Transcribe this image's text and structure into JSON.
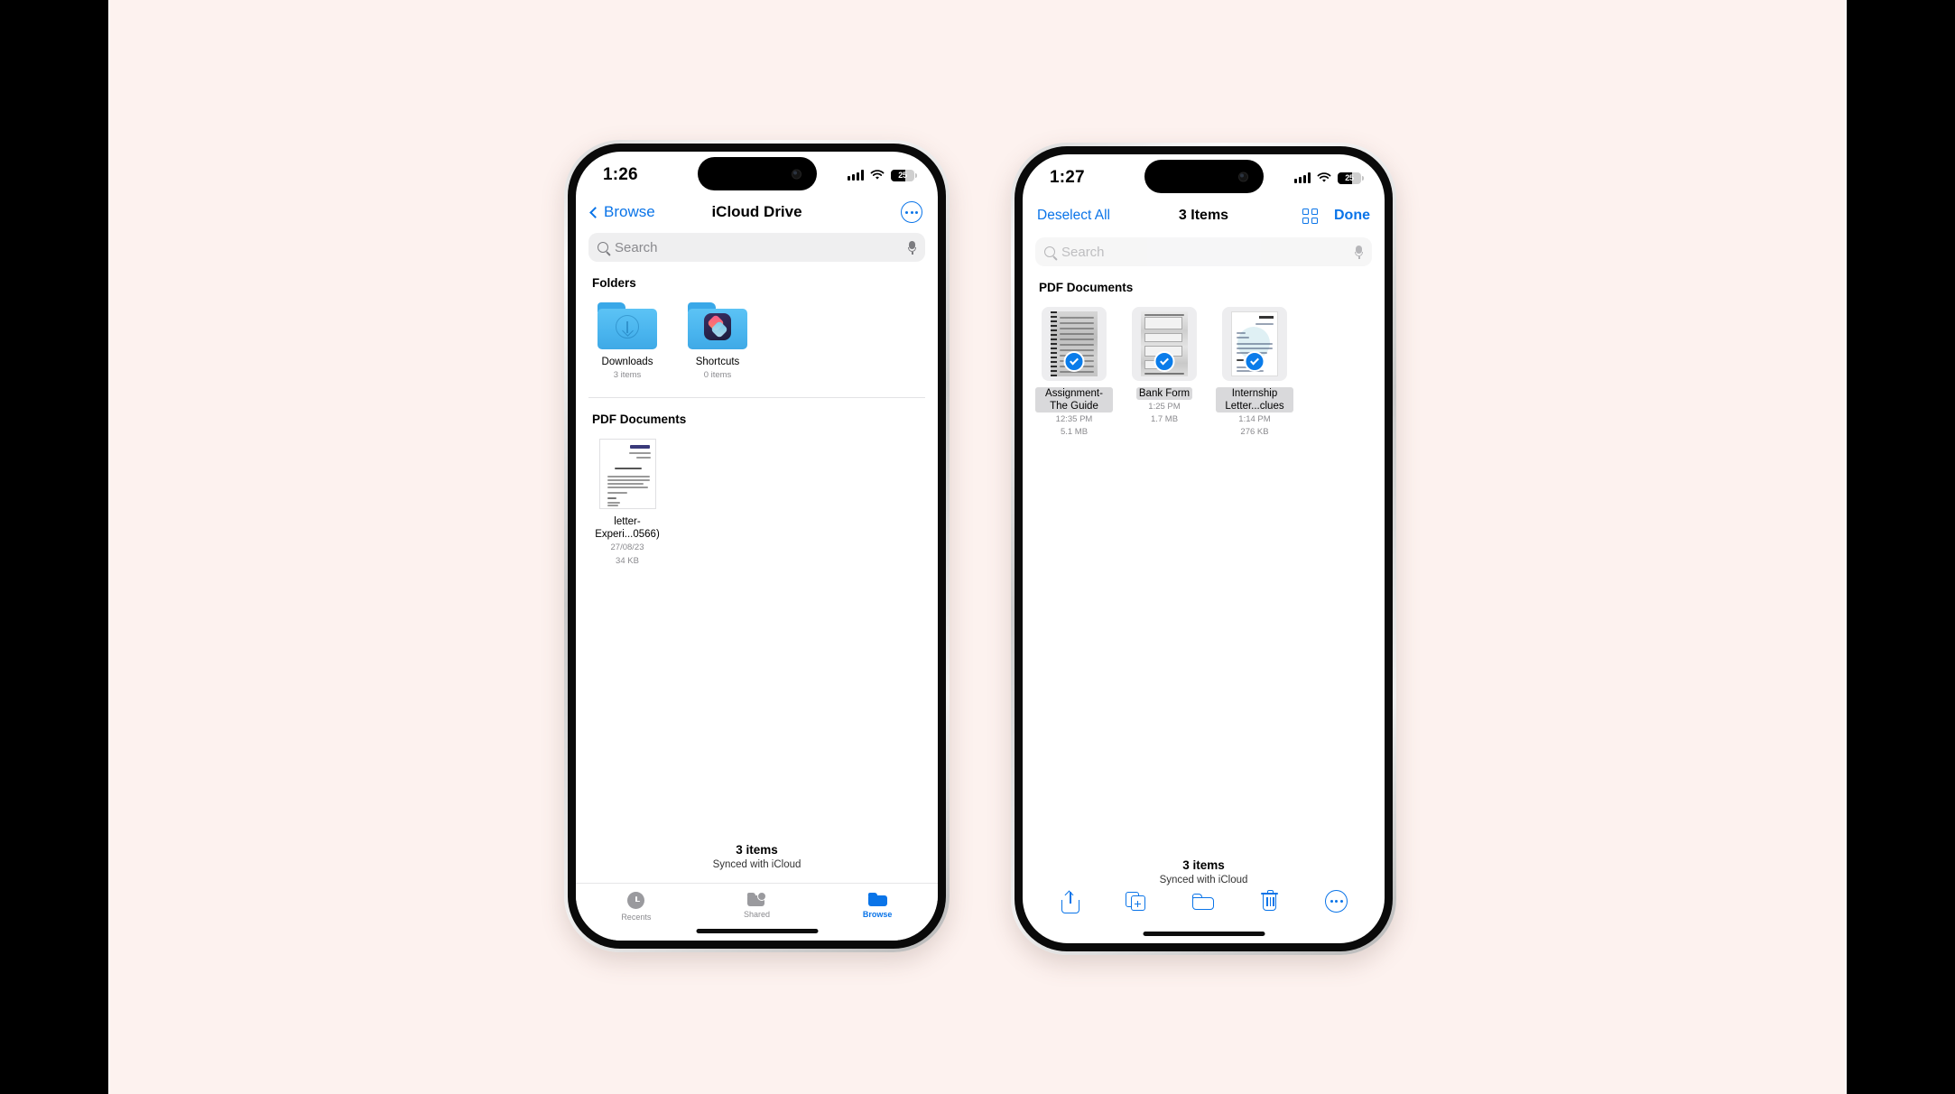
{
  "canvas": {
    "background": "#FDF2EF",
    "letterbox": "#000000",
    "accent": "#0A74E8"
  },
  "phone1": {
    "status": {
      "time": "1:26",
      "battery_level": "25",
      "signal_icon": "cellular-bars-icon",
      "wifi_icon": "wifi-icon",
      "battery_icon": "battery-icon"
    },
    "nav": {
      "back_label": "Browse",
      "title": "iCloud Drive",
      "more_icon": "more-circle-icon"
    },
    "search": {
      "placeholder": "Search",
      "search_icon": "search-icon",
      "mic_icon": "microphone-icon"
    },
    "sections": [
      {
        "header": "Folders",
        "items": [
          {
            "name": "Downloads",
            "sub": "3 items",
            "icon": "folder-download-icon"
          },
          {
            "name": "Shortcuts",
            "sub": "0 items",
            "icon": "folder-shortcuts-icon"
          }
        ]
      },
      {
        "header": "PDF Documents",
        "items": [
          {
            "name": "letter-Experi...0566)",
            "date": "27/08/23",
            "size": "34 KB",
            "icon": "pdf-document-icon"
          }
        ]
      }
    ],
    "footer": {
      "count": "3 items",
      "sync": "Synced with iCloud"
    },
    "tabs": [
      {
        "label": "Recents",
        "icon": "clock-icon",
        "active": false
      },
      {
        "label": "Shared",
        "icon": "shared-folder-icon",
        "active": false
      },
      {
        "label": "Browse",
        "icon": "folder-icon",
        "active": true
      }
    ]
  },
  "phone2": {
    "status": {
      "time": "1:27",
      "battery_level": "25",
      "signal_icon": "cellular-bars-icon",
      "wifi_icon": "wifi-icon",
      "battery_icon": "battery-icon"
    },
    "nav": {
      "deselect_label": "Deselect All",
      "title": "3 Items",
      "grid_icon": "grid-view-icon",
      "done_label": "Done"
    },
    "search": {
      "placeholder": "Search",
      "search_icon": "search-icon",
      "mic_icon": "microphone-icon"
    },
    "section": {
      "header": "PDF Documents",
      "items": [
        {
          "name": "Assignment-The Guide",
          "time": "12:35 PM",
          "size": "5.1 MB",
          "selected": true,
          "icon": "scanned-notebook-thumbnail"
        },
        {
          "name": "Bank Form",
          "time": "1:25 PM",
          "size": "1.7 MB",
          "selected": true,
          "icon": "scanned-form-thumbnail"
        },
        {
          "name": "Internship Letter...clues",
          "time": "1:14 PM",
          "size": "276 KB",
          "selected": true,
          "icon": "letter-document-thumbnail"
        }
      ]
    },
    "footer": {
      "count": "3 items",
      "sync": "Synced with iCloud"
    },
    "toolbar": [
      {
        "name": "share",
        "icon": "share-icon"
      },
      {
        "name": "duplicate",
        "icon": "duplicate-icon"
      },
      {
        "name": "move-to-folder",
        "icon": "folder-move-icon"
      },
      {
        "name": "delete",
        "icon": "trash-icon"
      },
      {
        "name": "more",
        "icon": "more-circle-icon"
      }
    ]
  }
}
